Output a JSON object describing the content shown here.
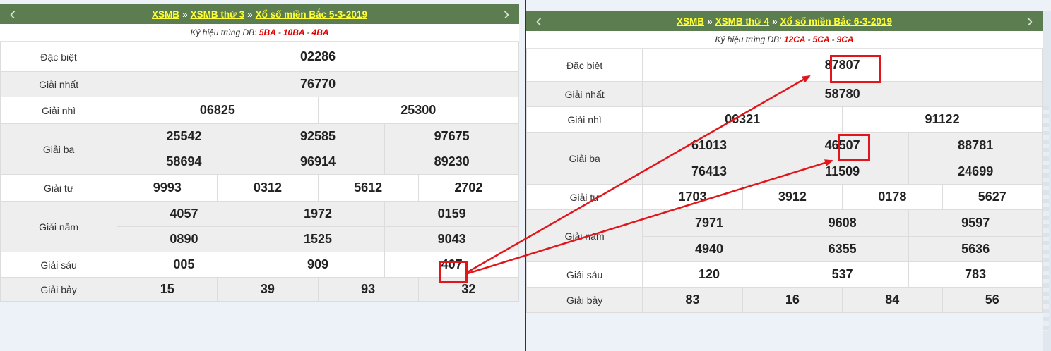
{
  "left": {
    "nav": {
      "prev_icon": "chevron-left-icon",
      "next_icon": "chevron-right-icon"
    },
    "breadcrumb": {
      "home": "XSMB",
      "weekday": "XSMB thứ 3",
      "page": "Xổ số miền Bắc 5-3-2019",
      "separator": "»"
    },
    "symbols": {
      "label": "Ký hiệu trúng ĐB:",
      "codes": [
        "5BA",
        "10BA",
        "4BA"
      ],
      "separator": "-"
    },
    "labels": {
      "special": "Đặc biệt",
      "first": "Giải nhất",
      "second": "Giải nhì",
      "third": "Giải ba",
      "fourth": "Giải tư",
      "fifth": "Giải năm",
      "sixth": "Giải sáu",
      "seventh": "Giải bảy"
    },
    "special": "02286",
    "first": "76770",
    "second": [
      "06825",
      "25300"
    ],
    "third": [
      "25542",
      "92585",
      "97675",
      "58694",
      "96914",
      "89230"
    ],
    "fourth": [
      "9993",
      "0312",
      "5612",
      "2702"
    ],
    "fifth": [
      "4057",
      "1972",
      "0159",
      "0890",
      "1525",
      "9043"
    ],
    "sixth": [
      "005",
      "909",
      "407"
    ],
    "seventh": [
      "15",
      "39",
      "93",
      "32"
    ]
  },
  "right": {
    "nav": {
      "prev_icon": "chevron-left-icon",
      "next_icon": "chevron-right-icon"
    },
    "breadcrumb": {
      "home": "XSMB",
      "weekday": "XSMB thứ 4",
      "page": "Xổ số miền Bắc 6-3-2019",
      "separator": "»"
    },
    "symbols": {
      "label": "Ký hiệu trúng ĐB:",
      "codes": [
        "12CA",
        "5CA",
        "9CA"
      ],
      "separator": "-"
    },
    "labels": {
      "special": "Đặc biệt",
      "first": "Giải nhất",
      "second": "Giải nhì",
      "third": "Giải ba",
      "fourth": "Giải tư",
      "fifth": "Giải năm",
      "sixth": "Giải sáu",
      "seventh": "Giải bảy"
    },
    "special": "87807",
    "first": "58780",
    "second": [
      "06321",
      "91122"
    ],
    "third": [
      "61013",
      "46507",
      "88781",
      "76413",
      "11509",
      "24699"
    ],
    "fourth": [
      "1703",
      "3912",
      "0178",
      "5627"
    ],
    "fifth": [
      "7971",
      "9608",
      "9597",
      "4940",
      "6355",
      "5636"
    ],
    "sixth": [
      "120",
      "537",
      "783"
    ],
    "seventh": [
      "83",
      "16",
      "84",
      "56"
    ]
  },
  "annotation": {
    "highlight_color": "#e0161b",
    "arrow_color": "#e0161b",
    "panel_header_color": "#5c7d50",
    "link_color": "#ffff33"
  }
}
